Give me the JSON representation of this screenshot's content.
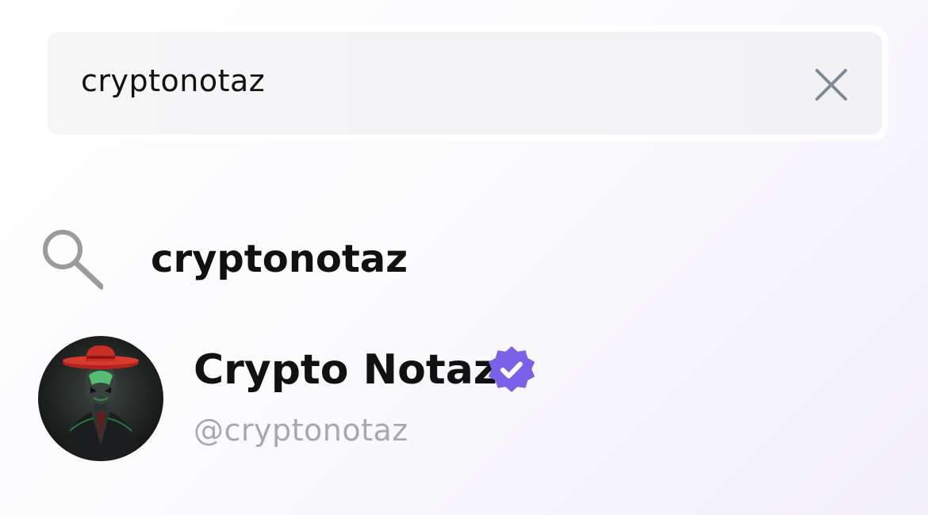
{
  "search": {
    "value": "cryptonotaz",
    "clear_icon": "close-icon"
  },
  "suggestion": {
    "icon": "search-icon",
    "text": "cryptonotaz"
  },
  "profile": {
    "name": "Crypto Notaz",
    "handle": "@cryptonotaz",
    "verified_icon": "verified-badge-icon",
    "verified_color": "#7b61e8"
  },
  "colors": {
    "text_primary": "#111111",
    "text_secondary": "#a9a9ab",
    "icon_gray": "#7f8b98",
    "search_bg": "#f4f4f6"
  }
}
